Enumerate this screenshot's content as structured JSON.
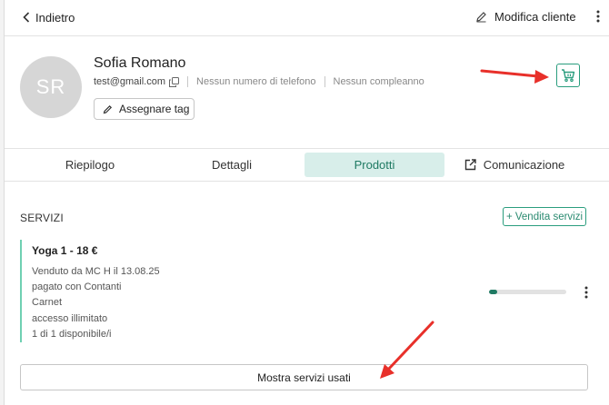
{
  "header": {
    "back_label": "Indietro",
    "edit_label": "Modifica cliente"
  },
  "customer": {
    "initials": "SR",
    "name": "Sofia Romano",
    "email": "test@gmail.com",
    "phone": "Nessun numero di telefono",
    "birthday": "Nessun compleanno",
    "tag_button_label": "Assegnare tag"
  },
  "tabs": [
    {
      "label": "Riepilogo",
      "active": false
    },
    {
      "label": "Dettagli",
      "active": false
    },
    {
      "label": "Prodotti",
      "active": true
    },
    {
      "label": "Comunicazione",
      "active": false
    }
  ],
  "services": {
    "section_title": "SERVIZI",
    "sell_button_label": "+ Vendita servizi",
    "items": [
      {
        "title": "Yoga 1 - 18 €",
        "sold_by": "Venduto da MC H il 13.08.25",
        "payment": "pagato con Contanti",
        "type": "Carnet",
        "access": "accesso illimitato",
        "availability": "1 di 1 disponibile/i",
        "progress_fraction": 0.1
      }
    ],
    "show_used_label": "Mostra servizi usati"
  },
  "colors": {
    "accent": "#2a9d7e",
    "active_tab_bg": "#d8eeea",
    "service_border": "#6fd0b2",
    "annotation_arrow": "#e8302a"
  },
  "icons": {
    "back": "chevron-left-icon",
    "edit": "pencil-icon",
    "more": "kebab-icon",
    "copy": "copy-icon",
    "tag": "pencil-icon",
    "cart": "cart-icon",
    "external": "external-link-icon"
  }
}
